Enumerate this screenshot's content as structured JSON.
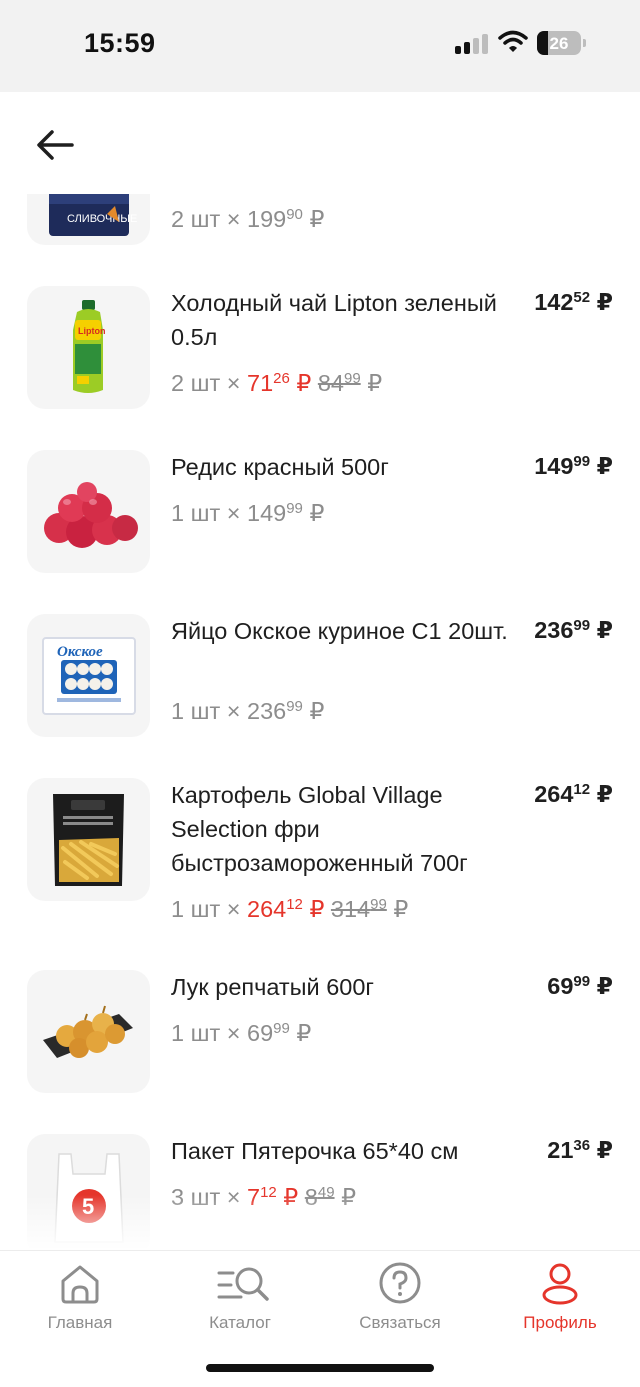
{
  "status_bar": {
    "time": "15:59",
    "battery": "26"
  },
  "currency": "₽",
  "items": [
    {
      "name": "",
      "thumb_label": "СЛИВОЧНЫЕ",
      "qty": "2 шт ×",
      "unit_int": "199",
      "unit_dec": "90",
      "old_int": "",
      "old_dec": "",
      "total_int": "",
      "total_dec": ""
    },
    {
      "name": "Холодный чай Lipton зеленый 0.5л",
      "thumb_label": "Lipton",
      "qty": "2 шт ×",
      "unit_int": "71",
      "unit_dec": "26",
      "old_int": "84",
      "old_dec": "99",
      "total_int": "142",
      "total_dec": "52"
    },
    {
      "name": "Редис красный 500г",
      "thumb_label": "",
      "qty": "1 шт ×",
      "unit_int": "149",
      "unit_dec": "99",
      "old_int": "",
      "old_dec": "",
      "total_int": "149",
      "total_dec": "99"
    },
    {
      "name": "Яйцо Окское куриное С1 20шт.",
      "thumb_label": "Окское",
      "qty": "1 шт ×",
      "unit_int": "236",
      "unit_dec": "99",
      "old_int": "",
      "old_dec": "",
      "total_int": "236",
      "total_dec": "99"
    },
    {
      "name": "Картофель Global Village Selection фри быстрозамороженный 700г",
      "thumb_label": "",
      "qty": "1 шт ×",
      "unit_int": "264",
      "unit_dec": "12",
      "old_int": "314",
      "old_dec": "99",
      "total_int": "264",
      "total_dec": "12"
    },
    {
      "name": "Лук репчатый 600г",
      "thumb_label": "",
      "qty": "1 шт ×",
      "unit_int": "69",
      "unit_dec": "99",
      "old_int": "",
      "old_dec": "",
      "total_int": "69",
      "total_dec": "99"
    },
    {
      "name": "Пакет Пятерочка 65*40 см",
      "thumb_label": "5",
      "qty": "3 шт ×",
      "unit_int": "7",
      "unit_dec": "12",
      "old_int": "8",
      "old_dec": "49",
      "total_int": "21",
      "total_dec": "36"
    }
  ],
  "tabbar": {
    "tabs": [
      {
        "label": "Главная",
        "icon": "home-icon",
        "active": false
      },
      {
        "label": "Каталог",
        "icon": "catalog-search-icon",
        "active": false
      },
      {
        "label": "Связаться",
        "icon": "help-icon",
        "active": false
      },
      {
        "label": "Профиль",
        "icon": "profile-icon",
        "active": true
      }
    ]
  },
  "colors": {
    "accent": "#e5352b",
    "muted": "#8d8d8d",
    "text": "#1f1f1f",
    "thumb_bg": "#f5f5f5"
  }
}
